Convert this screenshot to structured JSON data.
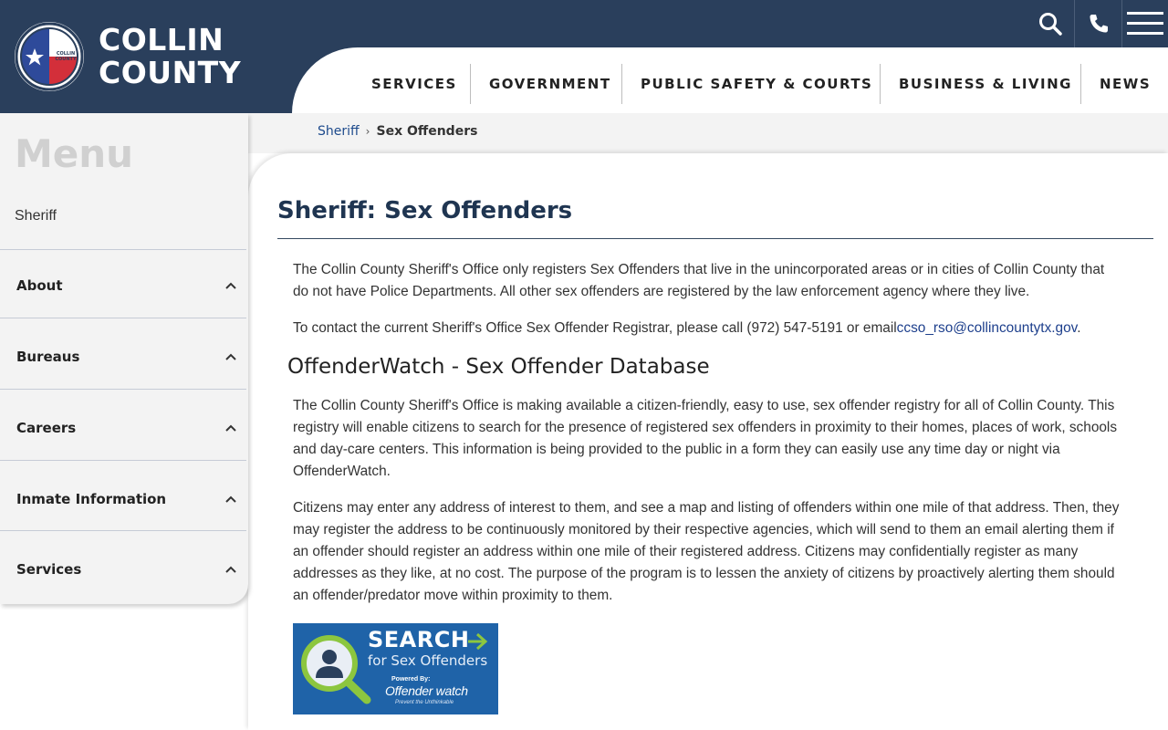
{
  "brand": {
    "line1": "COLLIN",
    "line2": "COUNTY"
  },
  "icons": {
    "search": "search-icon",
    "phone": "phone-icon",
    "menu": "hamburger-menu-icon",
    "seal": "texas-flag-seal-icon"
  },
  "nav": {
    "items": [
      "SERVICES",
      "GOVERNMENT",
      "PUBLIC SAFETY & COURTS",
      "BUSINESS & LIVING",
      "NEWS"
    ]
  },
  "breadcrumb": {
    "parent": "Sheriff",
    "current": "Sex Offenders"
  },
  "sidebar": {
    "title": "Menu",
    "top_link": "Sheriff",
    "items": [
      "About",
      "Bureaus",
      "Careers",
      "Inmate Information",
      "Services"
    ]
  },
  "main": {
    "title": "Sheriff: Sex Offenders",
    "p1": "The Collin County Sheriff's Office only registers Sex Offenders that live in the unincorporated areas or in cities of Collin County that do not have Police Departments. All other sex offenders are registered by the law enforcement agency where they live.",
    "p2_prefix": "To contact the current Sheriff's Office Sex Offender Registrar, please call (972) 547-5191 or email",
    "p2_email": "ccso_rso@collincountytx.gov",
    "p2_suffix": ".",
    "h2": "OffenderWatch - Sex Offender Database",
    "p3": "The Collin County Sheriff's Office is making available a citizen-friendly, easy to use, sex offender registry for all of Collin County. This registry will enable citizens to search for the presence of registered sex offenders in proximity to their homes, places of work, schools and day-care centers. This information is being provided to the public in a form they can easily use any time day or night via OffenderWatch.",
    "p4": "Citizens may enter any address of interest to them, and see a map and listing of offenders within one mile of that address. Then, they may register the address to be continuously monitored by their respective agencies, which will send to them an email alerting them if an offender should register an address within one mile of their registered address. Citizens may confidentially register as many addresses as they like, at no cost. The purpose of the program is to lessen the anxiety of citizens by proactively alerting them should an offender/predator move within proximity to them."
  },
  "banner": {
    "line1": "SEARCH",
    "line2": "for Sex Offenders",
    "powered": "Powered By:",
    "product": "Offender watch",
    "tagline": "Prevent the Unthinkable"
  },
  "colors": {
    "header": "#2a3f5c",
    "link": "#1d4a8c",
    "banner": "#1f63a8",
    "accent_green": "#8cc63f"
  }
}
